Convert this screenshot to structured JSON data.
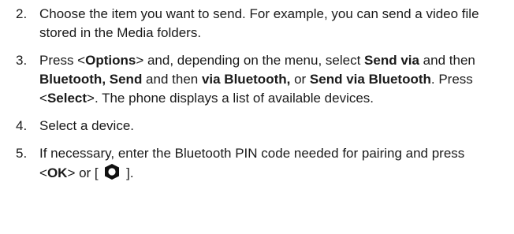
{
  "steps": [
    {
      "number": "2.",
      "segments": [
        {
          "text": "Choose the item you want to send. For example, you can send a video file stored in the Media folders.",
          "bold": false
        }
      ]
    },
    {
      "number": "3.",
      "segments": [
        {
          "text": "Press <",
          "bold": false
        },
        {
          "text": "Options",
          "bold": true
        },
        {
          "text": "> and, depending on the menu, select ",
          "bold": false
        },
        {
          "text": "Send via",
          "bold": true
        },
        {
          "text": " and then ",
          "bold": false
        },
        {
          "text": "Bluetooth, Send",
          "bold": true
        },
        {
          "text": " and then ",
          "bold": false
        },
        {
          "text": "via Bluetooth,",
          "bold": true
        },
        {
          "text": " or ",
          "bold": false
        },
        {
          "text": "Send via Bluetooth",
          "bold": true
        },
        {
          "text": ". Press <",
          "bold": false
        },
        {
          "text": "Select",
          "bold": true
        },
        {
          "text": ">. The phone displays a list of available devices.",
          "bold": false
        }
      ]
    },
    {
      "number": "4.",
      "segments": [
        {
          "text": "Select a device.",
          "bold": false
        }
      ]
    },
    {
      "number": "5.",
      "segments": [
        {
          "text": "If necessary, enter the Bluetooth PIN code needed for pairing and press <",
          "bold": false
        },
        {
          "text": "OK",
          "bold": true
        },
        {
          "text": "> or [ ",
          "bold": false
        },
        {
          "icon": "navigation-key-icon"
        },
        {
          "text": " ].",
          "bold": false
        }
      ]
    }
  ]
}
